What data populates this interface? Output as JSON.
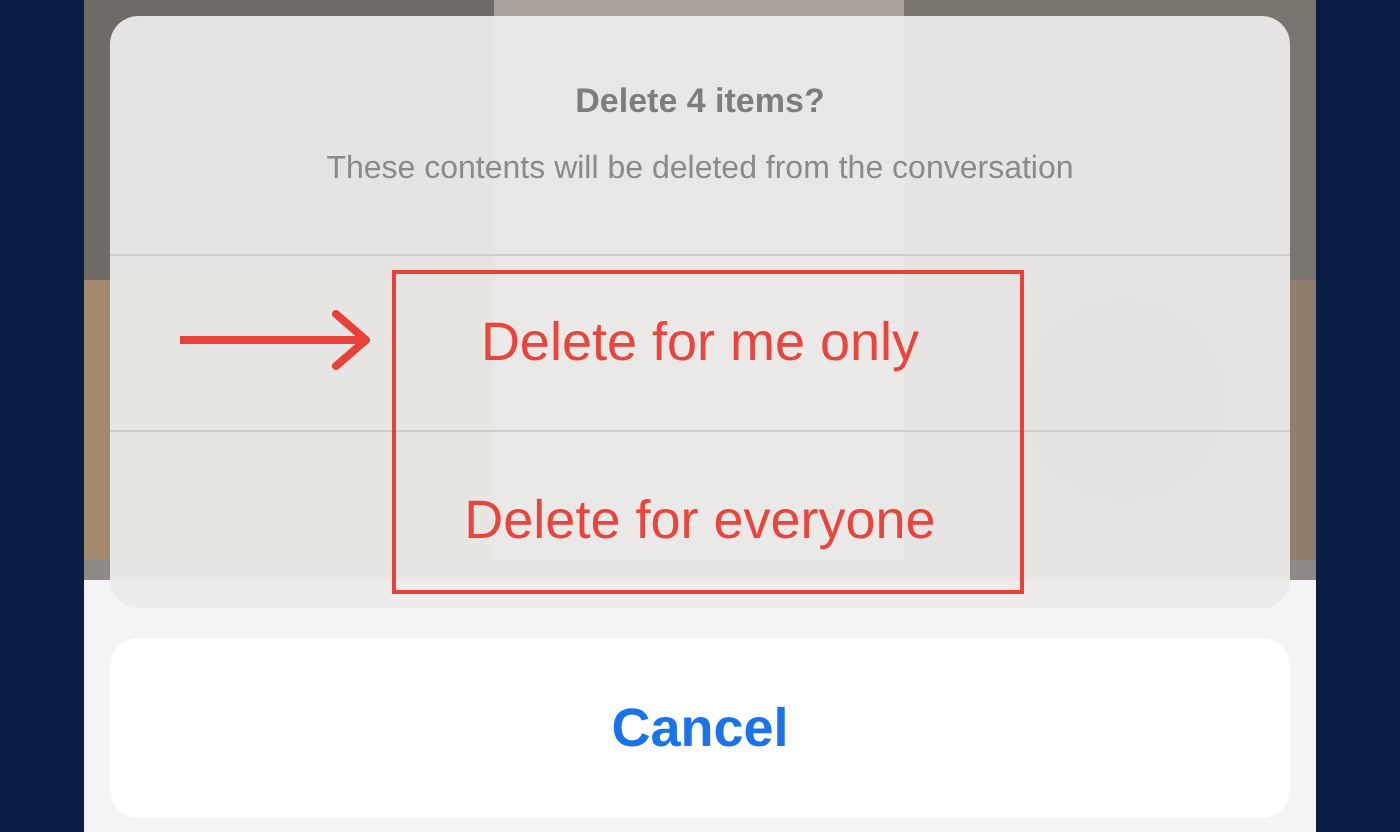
{
  "sheet": {
    "title": "Delete 4 items?",
    "message": "These contents will be deleted from the conversation",
    "actions": [
      {
        "label": "Delete for me only",
        "kind": "destructive"
      },
      {
        "label": "Delete for everyone",
        "kind": "destructive"
      }
    ]
  },
  "cancel": {
    "label": "Cancel"
  },
  "annotation": {
    "highlight": true,
    "arrow": true
  }
}
